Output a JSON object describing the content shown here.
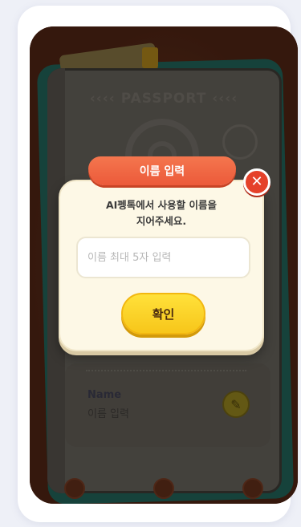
{
  "background": {
    "passport_title": "‹‹‹‹ PASSPORT ‹‹‹‹",
    "name_label": "Name",
    "name_placeholder": "이름 입력"
  },
  "modal": {
    "title": "이름 입력",
    "message_line1": "AI펭톡에서 사용할 이름을",
    "message_line2": "지어주세요.",
    "input_placeholder": "이름 최대 5자 입력",
    "input_value": "",
    "confirm_label": "확인",
    "close_symbol": "✕"
  },
  "colors": {
    "modal_bg": "#fdf8e6",
    "header": "#ec5a3a",
    "close": "#e5412a",
    "confirm": "#f7c61a"
  }
}
